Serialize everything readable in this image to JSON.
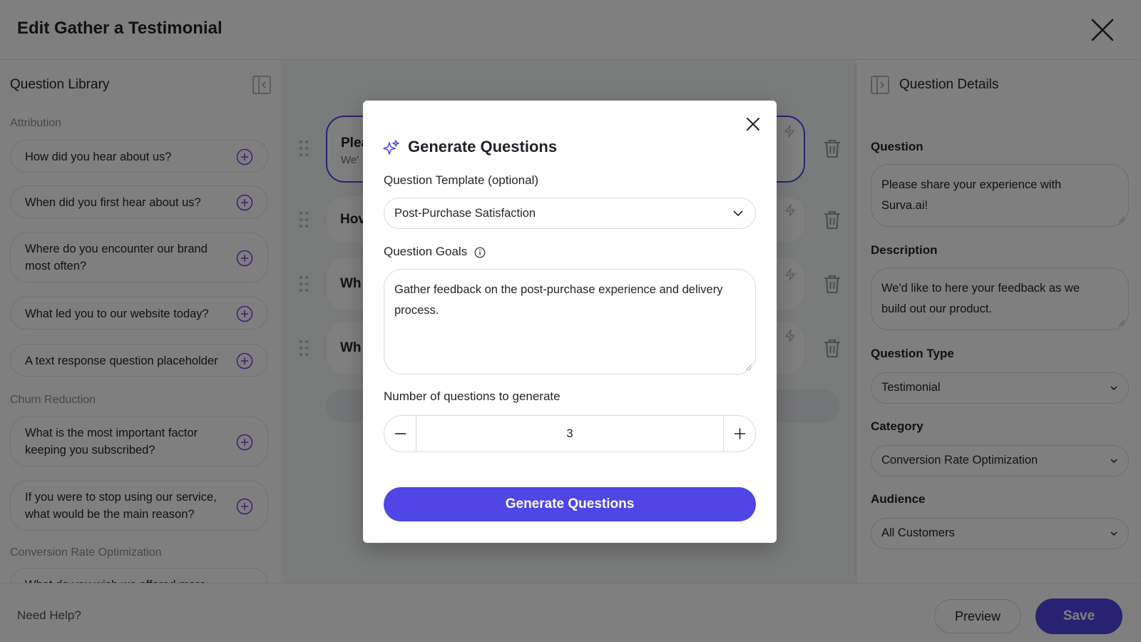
{
  "header": {
    "title": "Edit Gather a Testimonial"
  },
  "library": {
    "title": "Question Library",
    "categories": [
      {
        "label": "Attribution"
      },
      {
        "label": "Churn Reduction"
      },
      {
        "label": "Conversion Rate Optimization"
      }
    ],
    "items": [
      {
        "line1": "How did you hear about us?",
        "line2": ""
      },
      {
        "line1": "When did you first hear about us?",
        "line2": ""
      },
      {
        "line1": "Where do you encounter our brand",
        "line2": "most often?"
      },
      {
        "line1": "What led you to our website today?",
        "line2": ""
      },
      {
        "line1": "A text response question placeholder",
        "line2": ""
      },
      {
        "line1": "What is the most important factor",
        "line2": "keeping you subscribed?"
      },
      {
        "line1": "If you were to stop using our service,",
        "line2": "what would be the main reason?"
      },
      {
        "line1": "What do you wish we offered more",
        "line2": ""
      }
    ]
  },
  "canvas": {
    "rows": [
      {
        "title": "Plea",
        "subtitle": "We'"
      },
      {
        "title": "Hov",
        "subtitle": ""
      },
      {
        "title": "Wh",
        "subtitle": ""
      },
      {
        "title": "Wh",
        "subtitle": ""
      }
    ]
  },
  "details": {
    "title": "Question Details",
    "question_label": "Question",
    "question_line1": "Please share your experience with",
    "question_line2": "Surva.ai!",
    "description_label": "Description",
    "description_line1": "We'd like to here your feedback as we",
    "description_line2": "build out our product.",
    "type_label": "Question Type",
    "type_value": "Testimonial",
    "category_label": "Category",
    "category_value": "Conversion Rate Optimization",
    "audience_label": "Audience",
    "audience_value": "All Customers"
  },
  "footer": {
    "help": "Need Help?",
    "preview": "Preview",
    "save": "Save"
  },
  "modal": {
    "title": "Generate Questions",
    "template_label": "Question Template (optional)",
    "template_value": "Post-Purchase Satisfaction",
    "goals_label": "Question Goals",
    "goals_line1": "Gather feedback on the post-purchase experience and delivery",
    "goals_line2": "process.",
    "count_label": "Number of questions to generate",
    "count_value": "3",
    "generate_button": "Generate Questions"
  },
  "colors": {
    "accent": "#4f46e5",
    "overlay": "rgba(0,0,0,0.5)"
  }
}
